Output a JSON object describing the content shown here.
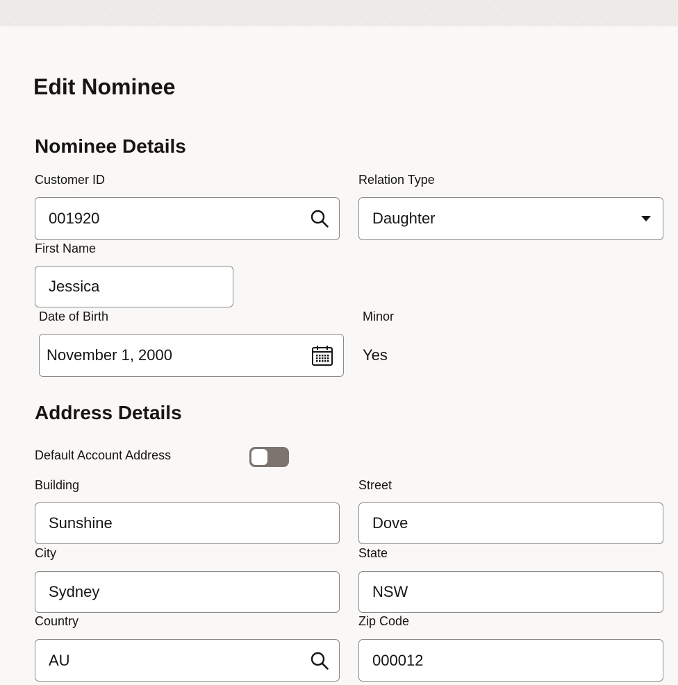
{
  "page": {
    "title": "Edit Nominee"
  },
  "nominee_details": {
    "heading": "Nominee Details",
    "customer_id": {
      "label": "Customer ID",
      "value": "001920",
      "icon": "search-icon"
    },
    "relation_type": {
      "label": "Relation Type",
      "value": "Daughter",
      "icon": "caret-down-icon"
    },
    "first_name": {
      "label": "First Name",
      "value": "Jessica"
    },
    "date_of_birth": {
      "label": "Date of Birth",
      "value": "November 1, 2000",
      "icon": "calendar-icon"
    },
    "minor": {
      "label": "Minor",
      "value": "Yes"
    }
  },
  "address_details": {
    "heading": "Address Details",
    "default_account_address": {
      "label": "Default Account Address",
      "enabled": false
    },
    "building": {
      "label": "Building",
      "value": "Sunshine"
    },
    "street": {
      "label": "Street",
      "value": "Dove"
    },
    "city": {
      "label": "City",
      "value": "Sydney"
    },
    "state": {
      "label": "State",
      "value": "NSW"
    },
    "country": {
      "label": "Country",
      "value": "AU",
      "icon": "search-icon"
    },
    "zip_code": {
      "label": "Zip Code",
      "value": "000012"
    }
  }
}
